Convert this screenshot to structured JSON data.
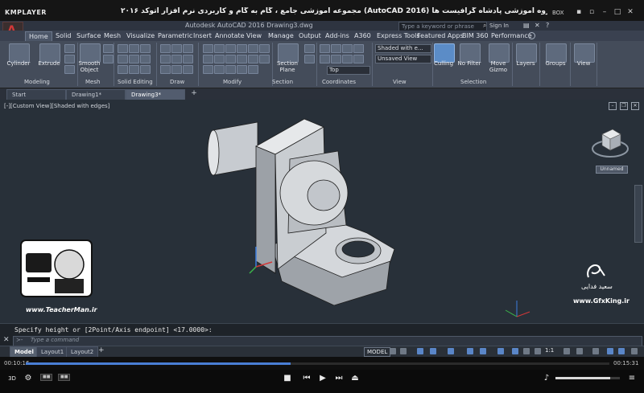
{
  "player": {
    "logo": "KMPLAYER",
    "video_title": "مجموعه آموزشی جامع ، گام به گام و کاربردی نرم افزار  اتوکد ۲۰۱۶ (AutoCAD 2016)   مدرس : سعید فدایی (تیچرمن ) گروه آموزشی پادشاه گرافیست ها",
    "box_label": "BOX",
    "time_elapsed": "00:10:16",
    "time_total": "00:15:31",
    "progress_fraction": 0.454,
    "volume_fraction": 0.85
  },
  "autocad": {
    "app_letter": "A",
    "window_title": "Autodesk AutoCAD 2016    Drawing3.dwg",
    "search_placeholder": "Type a keyword or phrase",
    "sign_in": "Sign In",
    "ribbon_tabs": [
      "Home",
      "Solid",
      "Surface",
      "Mesh",
      "Visualize",
      "Parametric",
      "Insert",
      "Annotate",
      "View",
      "Manage",
      "Output",
      "Add-ins",
      "A360",
      "Express Tools",
      "Featured Apps",
      "BIM 360",
      "Performance"
    ],
    "tools": {
      "cylinder": "Cylinder",
      "extrude": "Extrude",
      "smooth_object": "Smooth\nObject",
      "section_plane": "Section\nPlane",
      "culling": "Culling",
      "no_filter": "No Filter",
      "move_gizmo": "Move\nGizmo",
      "layers": "Layers",
      "groups": "Groups",
      "view": "View"
    },
    "panels": [
      "Modeling",
      "Mesh",
      "Solid Editing",
      "Draw",
      "Modify",
      "Section",
      "Coordinates",
      "View",
      "Selection"
    ],
    "visual_style": "Shaded with e...",
    "view_name": "Unsaved View",
    "ucs_view": "Top",
    "file_tabs": [
      "Start",
      "Drawing1*",
      "Drawing3*"
    ],
    "viewport_label": "[-][Custom View][Shaded with edges]",
    "viewcube_label": "Unnamed",
    "command_history": "Specify height or [2Point/Axis endpoint] <17.0000>:",
    "command_prompt": "≻-",
    "command_placeholder": "Type a command",
    "layout_tabs": [
      "Model",
      "Layout1",
      "Layout2"
    ],
    "status_model": "MODEL",
    "scale": "1:1"
  },
  "watermark": {
    "teacherman_url": "www.TeacherMan.ir",
    "gfx_name": "سعید فدایی",
    "gfx_url": "www.GfxKing.ir"
  },
  "colors": {
    "accent_blue": "#4a7fd6",
    "autocad_red": "#d23838"
  }
}
